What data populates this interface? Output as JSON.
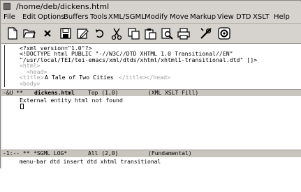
{
  "window": {
    "title": "/home/deb/dickens.html"
  },
  "menubar": {
    "items": [
      "File",
      "Edit",
      "Options",
      "Buffers",
      "Tools",
      "XML/SGML",
      "Modify",
      "Move",
      "Markup",
      "View",
      "DTD",
      "XSLT",
      "Help"
    ]
  },
  "toolbar": {
    "buttons": [
      {
        "icon": "new-file-icon"
      },
      {
        "icon": "open-folder-icon"
      },
      {
        "icon": "close-x-icon"
      },
      {
        "icon": "save-icon"
      },
      {
        "icon": "save-as-icon"
      },
      {
        "icon": "undo-icon"
      },
      {
        "icon": "cut-icon"
      },
      {
        "icon": "copy-icon"
      },
      {
        "icon": "paste-icon"
      },
      {
        "icon": "search-icon"
      },
      {
        "icon": "print-icon"
      },
      {
        "icon": "tools-icon"
      },
      {
        "icon": "settings-icon"
      }
    ]
  },
  "editor_top": {
    "lines": [
      "<?xml version=\"1.0\"?>",
      "<!DOCTYPE html PUBLIC \"-//W3C//DTD XHTML 1.0 Transitional//EN\"",
      "\"/usr/local/TEI/tei-emacs/xml/dtds/xhtml/xhtml1-transitional.dtd\" []>",
      "<html>",
      "  <head>",
      "<title>",
      "A Tale of Two Cities",
      "</title></head>",
      "<body>"
    ]
  },
  "modeline_top": {
    "flags": "-&U **",
    "buffer": "dickens.html",
    "position": "Top (1,0)",
    "mode": "(XML XSLT Fill)"
  },
  "editor_bottom": {
    "lines": [
      "External entity html not found"
    ]
  },
  "modeline_bottom": {
    "flags": "-1:-- **",
    "buffer": "*SGML LOG*",
    "position": "All (2,0)",
    "mode": "(Fundamental)"
  },
  "minibuffer": {
    "text": "menu-bar dtd insert dtd xhtml transitional"
  },
  "colors": {
    "chrome": "#d6d3ce",
    "modeline": "#c8c5bf",
    "markup_gray": "#a0a0a0"
  }
}
